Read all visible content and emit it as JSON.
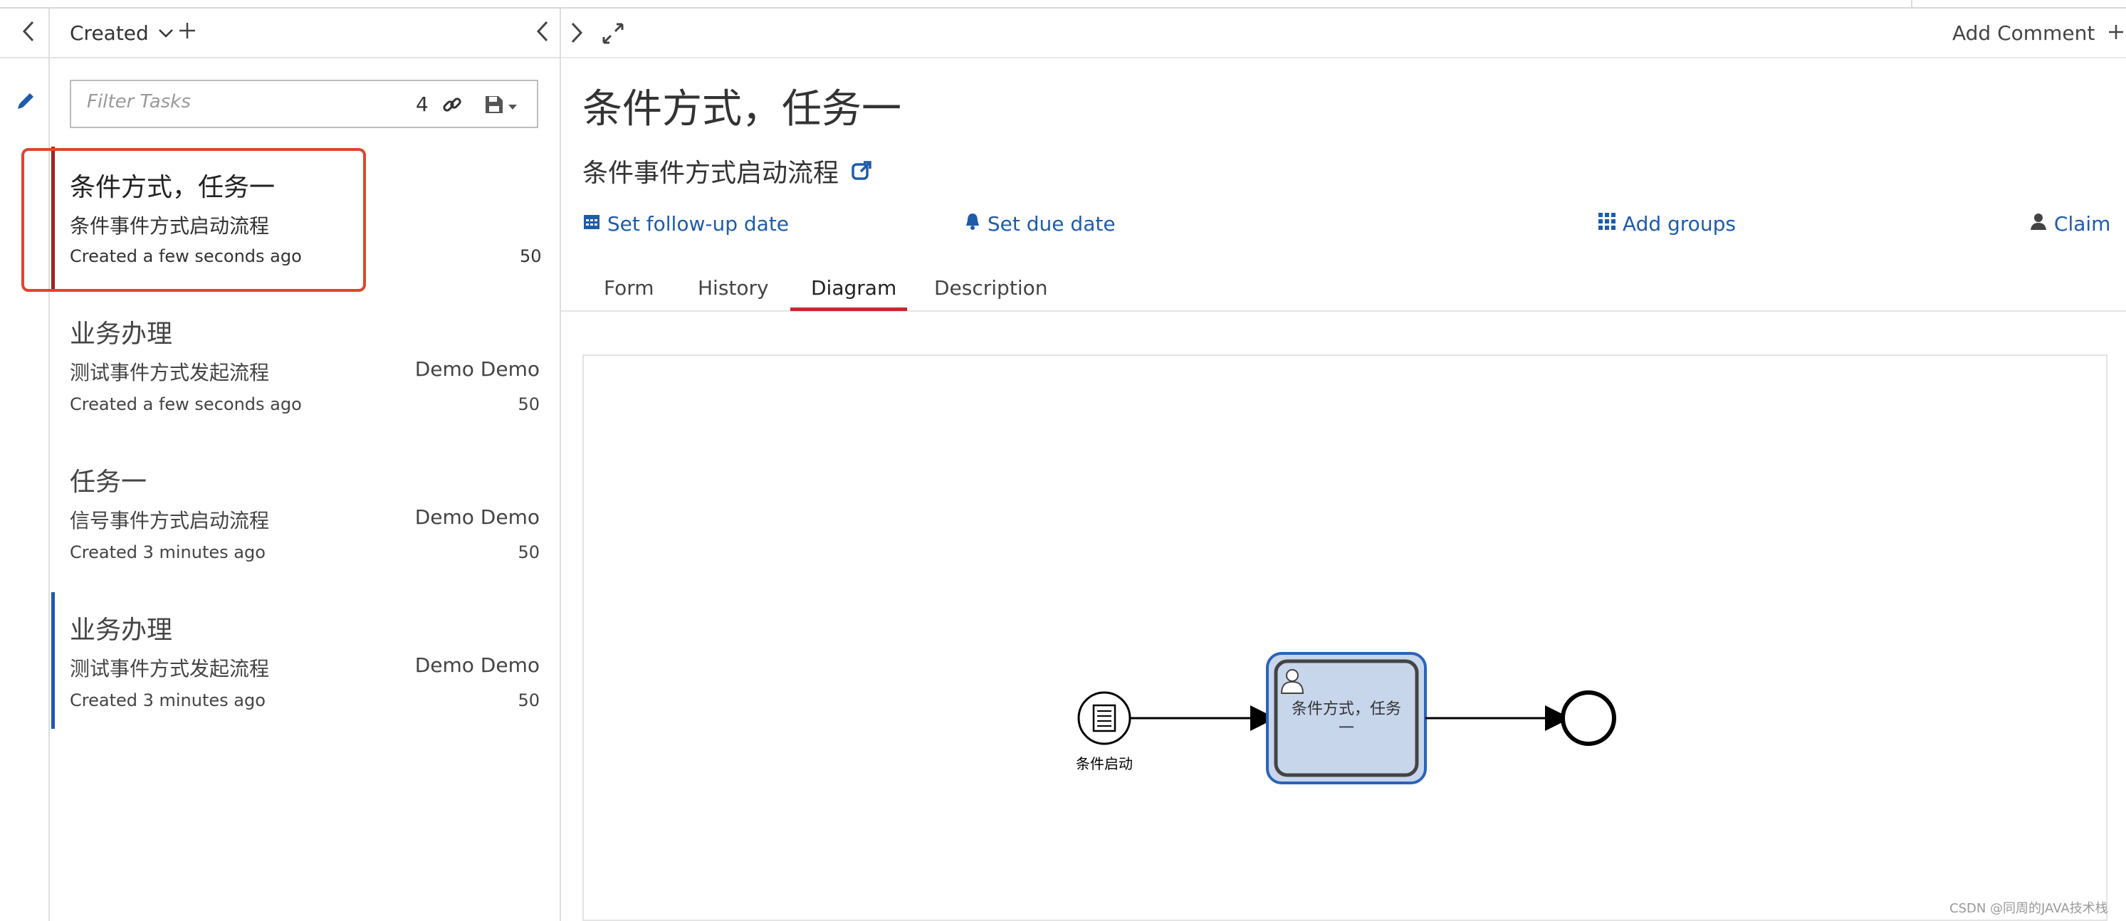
{
  "list_header": {
    "filter_name": "Created"
  },
  "filter": {
    "placeholder": "Filter Tasks",
    "count": "4"
  },
  "tasks": [
    {
      "title": "条件方式，任务一",
      "process": "条件事件方式启动流程",
      "assignee": "",
      "created": "Created a few seconds ago",
      "priority": "50"
    },
    {
      "title": "业务办理",
      "process": "测试事件方式发起流程",
      "assignee": "Demo Demo",
      "created": "Created a few seconds ago",
      "priority": "50"
    },
    {
      "title": "任务一",
      "process": "信号事件方式启动流程",
      "assignee": "Demo Demo",
      "created": "Created 3 minutes ago",
      "priority": "50"
    },
    {
      "title": "业务办理",
      "process": "测试事件方式发起流程",
      "assignee": "Demo Demo",
      "created": "Created 3 minutes ago",
      "priority": "50"
    }
  ],
  "detail": {
    "add_comment": "Add Comment",
    "title": "条件方式，任务一",
    "process_name": "条件事件方式启动流程",
    "actions": {
      "follow_up": "Set follow-up date",
      "due": "Set due date",
      "groups": "Add groups",
      "claim": "Claim"
    },
    "tabs": [
      "Form",
      "History",
      "Diagram",
      "Description"
    ],
    "active_tab": "Diagram"
  },
  "diagram": {
    "start_label": "条件启动",
    "task_label_line1": "条件方式，任务",
    "task_label_line2": "一"
  },
  "watermark": "CSDN @同周的JAVA技术栈",
  "colors": {
    "link": "#1f5bab",
    "selected_outline": "#e0452b",
    "accent_bar": "#1f5bab",
    "active_tab_underline": "#c8262e",
    "task_fill": "#c8d6ec",
    "task_highlight": "#2b63b9"
  }
}
